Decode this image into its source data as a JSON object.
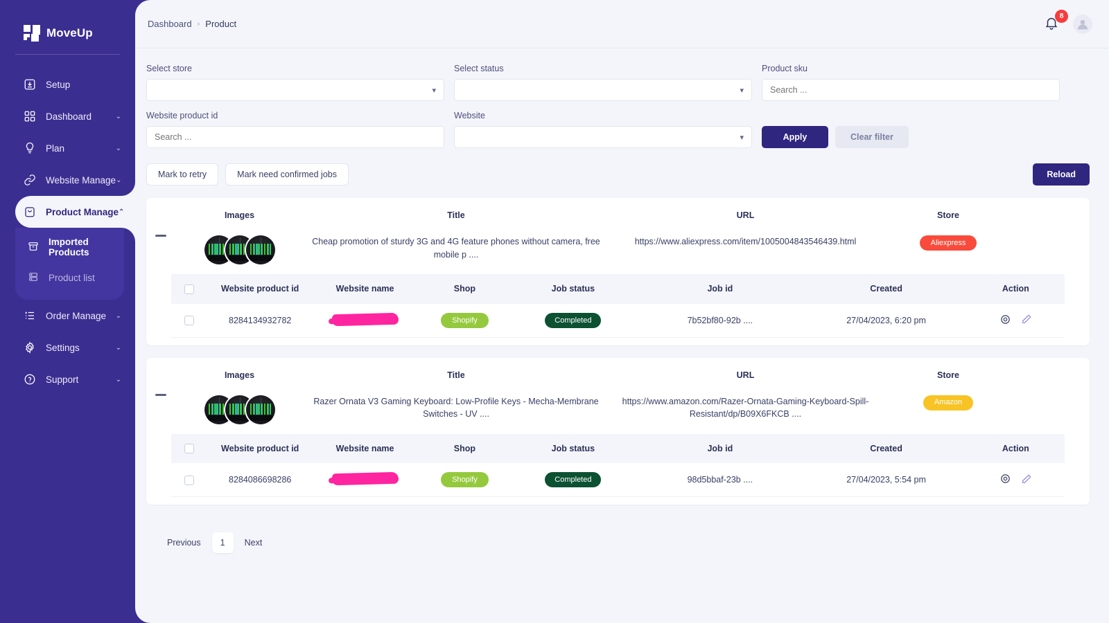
{
  "brand": {
    "name": "MoveUp",
    "logo_icon": "moveup-logo-icon"
  },
  "sidebar": {
    "items": [
      {
        "label": "Setup",
        "icon": "download-box-icon",
        "chevron": ""
      },
      {
        "label": "Dashboard",
        "icon": "grid-icon",
        "chevron": "⌄"
      },
      {
        "label": "Plan",
        "icon": "lightbulb-icon",
        "chevron": "⌄"
      },
      {
        "label": "Website Manage",
        "icon": "link-icon",
        "chevron": "⌄"
      },
      {
        "label": "Product Manage",
        "icon": "bag-icon",
        "chevron": "⌃"
      },
      {
        "label": "Order Manage",
        "icon": "list-icon",
        "chevron": "⌄"
      },
      {
        "label": "Settings",
        "icon": "gear-icon",
        "chevron": "⌄"
      },
      {
        "label": "Support",
        "icon": "question-circle-icon",
        "chevron": "⌄"
      }
    ],
    "subitems": [
      {
        "label": "Imported Products",
        "icon": "archive-icon"
      },
      {
        "label": "Product list",
        "icon": "server-list-icon"
      }
    ]
  },
  "topbar": {
    "breadcrumb_root": "Dashboard",
    "breadcrumb_sep": "›",
    "breadcrumb_current": "Product",
    "notification_count": "8",
    "bell_icon": "bell-icon",
    "avatar_icon": "user-avatar-icon"
  },
  "filters": {
    "select_store": {
      "label": "Select store",
      "value": ""
    },
    "select_status": {
      "label": "Select status",
      "value": ""
    },
    "product_sku": {
      "label": "Product sku",
      "value": "",
      "placeholder": "Search ..."
    },
    "website_product_id": {
      "label": "Website product id",
      "value": "",
      "placeholder": "Search ..."
    },
    "website": {
      "label": "Website",
      "value": ""
    },
    "apply_label": "Apply",
    "clear_label": "Clear filter"
  },
  "actions": {
    "mark_retry": "Mark to retry",
    "mark_confirmed": "Mark need confirmed jobs",
    "reload": "Reload"
  },
  "card_headers": {
    "images": "Images",
    "title": "Title",
    "url": "URL",
    "store": "Store"
  },
  "sub_headers": {
    "website_product_id": "Website product id",
    "website_name": "Website name",
    "shop": "Shop",
    "job_status": "Job status",
    "job_id": "Job id",
    "created": "Created",
    "action": "Action"
  },
  "cards": [
    {
      "collapse_icon": "minus-icon",
      "title": "Cheap promotion of sturdy 3G and 4G feature phones without camera, free mobile p ....",
      "url": "https://www.aliexpress.com/item/1005004843546439.html",
      "store": "Aliexpress",
      "store_color": "#F94B3C",
      "thumbnails": 3,
      "rows": [
        {
          "website_product_id": "8284134932782",
          "website_name": "",
          "website_name_redacted": true,
          "shop": "Shopify",
          "job_status": "Completed",
          "job_id": "7b52bf80-92b ....",
          "created": "27/04/2023, 6:20 pm",
          "view_icon": "eye-icon",
          "edit_icon": "pencil-icon"
        }
      ]
    },
    {
      "collapse_icon": "minus-icon",
      "title": "Razer Ornata V3 Gaming Keyboard: Low-Profile Keys - Mecha-Membrane Switches - UV ....",
      "url": "https://www.amazon.com/Razer-Ornata-Gaming-Keyboard-Spill-Resistant/dp/B09X6FKCB ....",
      "store": "Amazon",
      "store_color": "#F7C325",
      "thumbnails": 3,
      "rows": [
        {
          "website_product_id": "8284086698286",
          "website_name": "",
          "website_name_redacted": true,
          "shop": "Shopify",
          "job_status": "Completed",
          "job_id": "98d5bbaf-23b ....",
          "created": "27/04/2023, 5:54 pm",
          "view_icon": "eye-icon",
          "edit_icon": "pencil-icon"
        }
      ]
    }
  ],
  "pagination": {
    "previous": "Previous",
    "current": "1",
    "next": "Next"
  },
  "colors": {
    "sidebar_bg": "#3B2E91",
    "main_bg": "#F4F5FA",
    "primary": "#2F2680",
    "badge_red": "#F63C3C",
    "shopify_green": "#95C93D",
    "completed_green": "#0B5132"
  }
}
